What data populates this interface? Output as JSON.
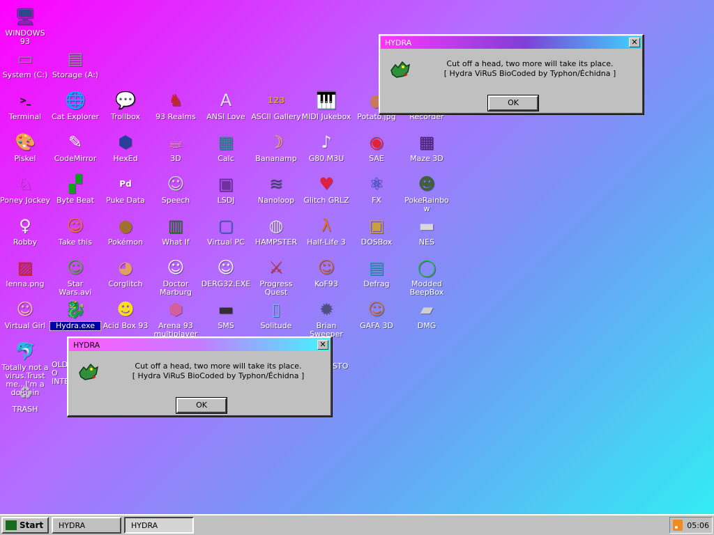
{
  "desktop": {
    "icons": [
      {
        "label": "WINDOWS 93",
        "icon": "computer-icon",
        "glyph": "🖥",
        "color": "#2a4a8a"
      },
      {
        "label": "System (C:)",
        "icon": "hard-drive-icon",
        "glyph": "▭",
        "color": "#8f8f8f"
      },
      {
        "label": "Storage (A:)",
        "icon": "floppy-drive-icon",
        "glyph": "▤",
        "color": "#8f8f8f"
      },
      {
        "label": "Terminal",
        "icon": "terminal-icon",
        "glyph": ">_",
        "color": "#101010"
      },
      {
        "label": "Cat Explorer",
        "icon": "cat-globe-icon",
        "glyph": "🌐",
        "color": "#2f8a2f"
      },
      {
        "label": "Trollbox",
        "icon": "chat-bubble-icon",
        "glyph": "💬",
        "color": "#3fb4e8"
      },
      {
        "label": "93 Realms",
        "icon": "knight-icon",
        "glyph": "♞",
        "color": "#c0282d"
      },
      {
        "label": "ANSI Love",
        "icon": "ansi-letter-icon",
        "glyph": "A",
        "color": "#e0e0ff"
      },
      {
        "label": "ASCII Gallery",
        "icon": "ascii-123-icon",
        "glyph": "123",
        "color": "#d0a020"
      },
      {
        "label": "MIDI Jukebox",
        "icon": "piano-keys-icon",
        "glyph": "🎹",
        "color": "#f4f4f4"
      },
      {
        "label": "Potato.jpg",
        "icon": "potato-icon",
        "glyph": "●",
        "color": "#c9785a"
      },
      {
        "label": "Recorder",
        "icon": "recorder-icon",
        "glyph": "●",
        "color": "#a04040"
      },
      {
        "label": "Piskel",
        "icon": "palette-icon",
        "glyph": "🎨",
        "color": "#f0c060"
      },
      {
        "label": "CodeMirror",
        "icon": "code-mirror-icon",
        "glyph": "✎",
        "color": "#ffffff"
      },
      {
        "label": "HexEd",
        "icon": "hex-cube-icon",
        "glyph": "⬢",
        "color": "#2a3f9a"
      },
      {
        "label": "3D",
        "icon": "teapot-icon",
        "glyph": "☕",
        "color": "#e0a0a0"
      },
      {
        "label": "Calc",
        "icon": "calculator-icon",
        "glyph": "▦",
        "color": "#209090"
      },
      {
        "label": "Bananamp",
        "icon": "banana-icon",
        "glyph": "☽",
        "color": "#f4d020"
      },
      {
        "label": "G80.M3U",
        "icon": "music-playlist-icon",
        "glyph": "♪",
        "color": "#f0f0f0"
      },
      {
        "label": "SAE",
        "icon": "amiga-ball-icon",
        "glyph": "◉",
        "color": "#e82030"
      },
      {
        "label": "Maze 3D",
        "icon": "maze-icon",
        "glyph": "▦",
        "color": "#502080"
      },
      {
        "label": "Poney Jockey",
        "icon": "pony-icon",
        "glyph": "♘",
        "color": "#c050d0"
      },
      {
        "label": "Byte Beat",
        "icon": "byte-beat-icon",
        "glyph": "▞",
        "color": "#10a020"
      },
      {
        "label": "Puke Data",
        "icon": "pd-patch-icon",
        "glyph": "Pd",
        "color": "#ffffff"
      },
      {
        "label": "Speech",
        "icon": "face-speech-icon",
        "glyph": "☺",
        "color": "#d0d0d0"
      },
      {
        "label": "LSDJ",
        "icon": "gameboy-icon",
        "glyph": "▣",
        "color": "#7030a0"
      },
      {
        "label": "Nanoloop",
        "icon": "waveform-icon",
        "glyph": "≋",
        "color": "#404070"
      },
      {
        "label": "Glitch GRLZ",
        "icon": "lips-icon",
        "glyph": "♥",
        "color": "#e02040"
      },
      {
        "label": "FX",
        "icon": "atom-icon",
        "glyph": "⚛",
        "color": "#2050c0"
      },
      {
        "label": "PokeRainbow",
        "icon": "pokemon-trainers-icon",
        "glyph": "☻",
        "color": "#406040"
      },
      {
        "label": "Robby",
        "icon": "stick-figure-icon",
        "glyph": "♀",
        "color": "#ffffff"
      },
      {
        "label": "Take this",
        "icon": "pixel-character-icon",
        "glyph": "☺",
        "color": "#f07020"
      },
      {
        "label": "Pokémon",
        "icon": "pokemon-icon",
        "glyph": "●",
        "color": "#a07030"
      },
      {
        "label": "What If",
        "icon": "equalizer-icon",
        "glyph": "▥",
        "color": "#207020"
      },
      {
        "label": "Virtual PC",
        "icon": "virtual-pc-icon",
        "glyph": "▢",
        "color": "#4060c0"
      },
      {
        "label": "HAMPSTER",
        "icon": "owl-icon",
        "glyph": "◍",
        "color": "#e0e0e0"
      },
      {
        "label": "Half-Life 3",
        "icon": "half-life-icon",
        "glyph": "λ",
        "color": "#e07010"
      },
      {
        "label": "DOSBox",
        "icon": "dosbox-icon",
        "glyph": "▣",
        "color": "#c8a040"
      },
      {
        "label": "NES",
        "icon": "nes-console-icon",
        "glyph": "▬",
        "color": "#d8d8d8"
      },
      {
        "label": "lenna.png",
        "icon": "image-file-icon",
        "glyph": "▨",
        "color": "#e02020"
      },
      {
        "label": "Star Wars.avi",
        "icon": "yoda-icon",
        "glyph": "☺",
        "color": "#60a040"
      },
      {
        "label": "Corglitch",
        "icon": "corgi-icon",
        "glyph": "◕",
        "color": "#e0a060"
      },
      {
        "label": "Doctor Marburg",
        "icon": "doctor-icon",
        "glyph": "☺",
        "color": "#f0f0f0"
      },
      {
        "label": "DERG32.EXE",
        "icon": "terminal-face-icon",
        "glyph": "☺",
        "color": "#f0f0f0"
      },
      {
        "label": "Progress Quest",
        "icon": "crossed-swords-icon",
        "glyph": "⚔",
        "color": "#c03030"
      },
      {
        "label": "KoF93",
        "icon": "fighter-icon",
        "glyph": "☺",
        "color": "#c06040"
      },
      {
        "label": "Defrag",
        "icon": "defrag-icon",
        "glyph": "▤",
        "color": "#30a0c0"
      },
      {
        "label": "Modded BeepBox",
        "icon": "ring-icon",
        "glyph": "◯",
        "color": "#20b040"
      },
      {
        "label": "Virtual Girl",
        "icon": "virtual-girl-icon",
        "glyph": "☺",
        "color": "#f0c0a0"
      },
      {
        "label": "Hydra.exe",
        "icon": "hydra-dragon-icon",
        "glyph": "🐉",
        "color": "#4060c0"
      },
      {
        "label": "Acid Box 93",
        "icon": "smiley-icon",
        "glyph": "☻",
        "color": "#f4e020"
      },
      {
        "label": "Arena 93 multiplayer",
        "icon": "cube-icon",
        "glyph": "⬢",
        "color": "#d060a0"
      },
      {
        "label": "SMS",
        "icon": "sega-master-system-icon",
        "glyph": "▬",
        "color": "#303030"
      },
      {
        "label": "Solitude",
        "icon": "solitude-icon",
        "glyph": "▯",
        "color": "#60c0e0"
      },
      {
        "label": "Brian Sweeper",
        "icon": "mine-icon",
        "glyph": "✹",
        "color": "#505080"
      },
      {
        "label": "GAFA 3D",
        "icon": "doom-face-icon",
        "glyph": "☺",
        "color": "#c07040"
      },
      {
        "label": "DMG",
        "icon": "dmg-disk-icon",
        "glyph": "▰",
        "color": "#d0d0d0"
      },
      {
        "label": "Totally not a virus.Trust me...I'm a dolphin",
        "icon": "dolphin-icon",
        "glyph": "🐬",
        "color": "#40a0d0"
      },
      {
        "label": "TRASH",
        "icon": "trash-icon",
        "glyph": "♻",
        "color": "#c0c0c0"
      }
    ],
    "partial_labels": {
      "oldschool": "OLD O INTE",
      "custo": "STO"
    }
  },
  "dialogs": [
    {
      "title": "HYDRA",
      "icon": "hydra-dragon-icon",
      "line1": "Cut off a head, two more will take its place.",
      "line2": "[ Hydra ViRuS BioCoded by Typhon/Échidna ]",
      "ok_label": "OK",
      "close_glyph": "✕"
    },
    {
      "title": "HYDRA",
      "icon": "hydra-dragon-icon",
      "line1": "Cut off a head, two more will take its place.",
      "line2": "[ Hydra ViRuS BioCoded by Typhon/Échidna ]",
      "ok_label": "OK",
      "close_glyph": "✕"
    }
  ],
  "taskbar": {
    "start_label": "Start",
    "tasks": [
      {
        "label": "HYDRA",
        "active": false
      },
      {
        "label": "HYDRA",
        "active": true
      }
    ],
    "clock": "05:06"
  }
}
